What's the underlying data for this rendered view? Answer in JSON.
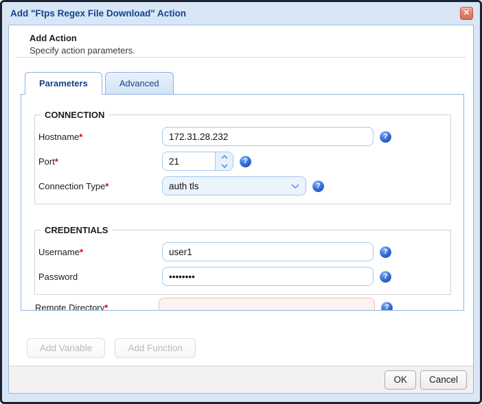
{
  "dialog": {
    "title": "Add \"Ftps Regex File Download\" Action"
  },
  "icons": {
    "close": "✕",
    "help": "?"
  },
  "header": {
    "title": "Add Action",
    "subtitle": "Specify action parameters."
  },
  "tabs": [
    {
      "label": "Parameters",
      "active": true
    },
    {
      "label": "Advanced",
      "active": false
    }
  ],
  "form": {
    "required_marker": "*",
    "sections": [
      {
        "legend": "CONNECTION",
        "fields": [
          {
            "label": "Hostname",
            "required": true,
            "type": "text",
            "value": "172.31.28.232"
          },
          {
            "label": "Port",
            "required": true,
            "type": "spinner",
            "value": "21"
          },
          {
            "label": "Connection Type",
            "required": true,
            "type": "select",
            "value": "auth tls"
          }
        ]
      },
      {
        "legend": "CREDENTIALS",
        "fields": [
          {
            "label": "Username",
            "required": true,
            "type": "text",
            "value": "user1"
          },
          {
            "label": "Password",
            "required": false,
            "type": "password",
            "value": "••••••••"
          }
        ]
      }
    ],
    "clipped_field": {
      "label": "Remote Directory",
      "required": true,
      "value": "",
      "invalid": true
    }
  },
  "toolbar": {
    "add_variable_label": "Add Variable",
    "add_function_label": "Add Function"
  },
  "footer": {
    "ok_label": "OK",
    "cancel_label": "Cancel"
  },
  "colors": {
    "accent": "#15428b",
    "panel_border": "#8db2e3",
    "invalid_bg": "#fdf2f2",
    "invalid_border": "#efb9b9",
    "help_icon_blue": "#2a5fd0",
    "close_btn_red": "#d96c55"
  }
}
